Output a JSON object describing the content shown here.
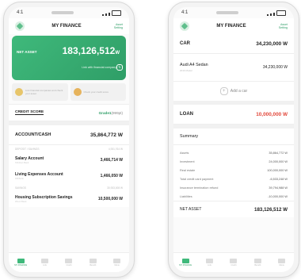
{
  "status_time": "4:1",
  "left": {
    "header": {
      "title": "MY FINANCE",
      "settings_label": "Asset Setting"
    },
    "net_asset": {
      "label": "NET ASSET",
      "value": "183,126,512",
      "unit": "W",
      "link_text": "Link with financial company"
    },
    "promos": [
      {
        "text": "Link financial companies and check your asset"
      },
      {
        "text": "Check your credit score"
      }
    ],
    "credit": {
      "label": "CREDIT SCORE",
      "value": "Grade1",
      "pts": "(999pt)"
    },
    "account": {
      "label": "ACCOUNT/CASH",
      "value": "35,864,772 W"
    },
    "deposit_group": {
      "label": "DEPOSIT / SAVINGS",
      "value": "4,931,764 W"
    },
    "items": [
      {
        "label": "Salary Account",
        "desc": "Shinhan Bank",
        "value": "3,466,714 W"
      },
      {
        "label": "Living Expenses Account",
        "desc": "KB Bank",
        "value": "1,466,050 W"
      }
    ],
    "savings_group": {
      "label": "SAVINGS",
      "value": "30,933,008 W"
    },
    "items2": [
      {
        "label": "Housing Subscription Savings",
        "desc": "Woori Bank",
        "value": "10,500,000 W"
      }
    ],
    "tabs": [
      {
        "label": "MY FINANCE"
      },
      {
        "label": "Link"
      },
      {
        "label": "Credit"
      },
      {
        "label": "Benefit"
      },
      {
        "label": "Menu"
      }
    ]
  },
  "right": {
    "header": {
      "title": "MY FINANCE",
      "settings_label": "Asset Setting"
    },
    "car": {
      "label": "CAR",
      "value": "34,230,000 W"
    },
    "car_item": {
      "name": "Audi  A4 Sedan",
      "desc": "2016 Model",
      "value": "34,230,000 W"
    },
    "add_car": "Add a car",
    "loan": {
      "label": "LOAN",
      "value": "10,000,000 W"
    },
    "summary_title": "Summary",
    "summary": [
      {
        "label": "Assets",
        "value": "35,864,772 W"
      },
      {
        "label": "Investment",
        "value": "24,000,000 W"
      },
      {
        "label": "Real estate",
        "value": "100,000,000 W"
      },
      {
        "label": "Total credit card payment",
        "value": "-6,533,248 W"
      },
      {
        "label": "Insurance termination refund",
        "value": "39,794,988 W"
      },
      {
        "label": "Liabilities",
        "value": "-10,000,000 W"
      }
    ],
    "total": {
      "label": "NET ASSET",
      "value": "183,126,512 W"
    },
    "tabs": [
      {
        "label": "MY FINANCE"
      },
      {
        "label": "Link"
      },
      {
        "label": "Credit"
      },
      {
        "label": "Benefit"
      },
      {
        "label": "Menu"
      }
    ]
  }
}
